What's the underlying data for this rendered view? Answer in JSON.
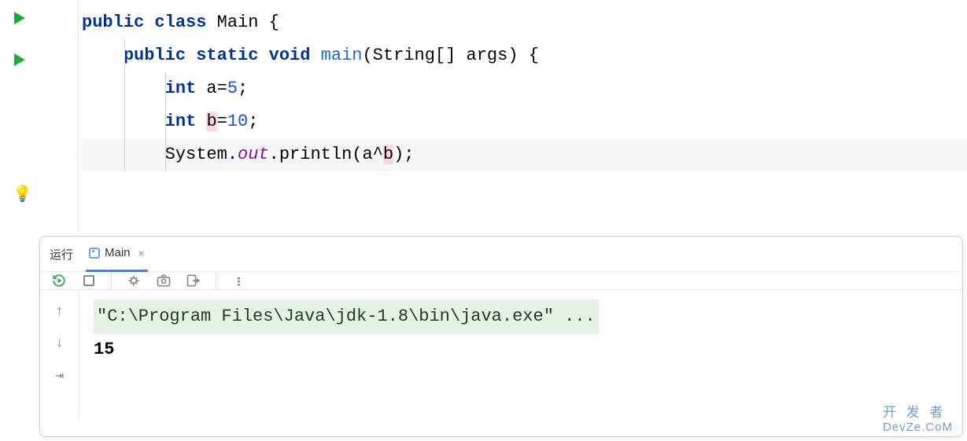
{
  "code": {
    "lines": [
      {
        "gutter": "run",
        "tokens": [
          {
            "t": "kw",
            "v": "public"
          },
          {
            "t": "plain",
            "v": " "
          },
          {
            "t": "kw",
            "v": "class"
          },
          {
            "t": "plain",
            "v": " "
          },
          {
            "t": "cls",
            "v": "Main"
          },
          {
            "t": "plain",
            "v": " {"
          }
        ]
      },
      {
        "gutter": "run",
        "indent": 1,
        "tokens": [
          {
            "t": "kw",
            "v": "public"
          },
          {
            "t": "plain",
            "v": " "
          },
          {
            "t": "kw",
            "v": "static"
          },
          {
            "t": "plain",
            "v": " "
          },
          {
            "t": "kw",
            "v": "void"
          },
          {
            "t": "plain",
            "v": " "
          },
          {
            "t": "method",
            "v": "main"
          },
          {
            "t": "plain",
            "v": "(String[] args) {"
          }
        ]
      },
      {
        "indent": 2,
        "tokens": [
          {
            "t": "kw",
            "v": "int"
          },
          {
            "t": "plain",
            "v": " a="
          },
          {
            "t": "num",
            "v": "5"
          },
          {
            "t": "plain",
            "v": ";"
          }
        ]
      },
      {
        "indent": 2,
        "tokens": [
          {
            "t": "kw",
            "v": "int"
          },
          {
            "t": "plain",
            "v": " "
          },
          {
            "t": "highlight-char",
            "v": "b"
          },
          {
            "t": "plain",
            "v": "="
          },
          {
            "t": "num",
            "v": "10"
          },
          {
            "t": "plain",
            "v": ";"
          }
        ]
      },
      {
        "gutter": "bulb",
        "highlighted": true,
        "indent": 2,
        "tokens": [
          {
            "t": "plain",
            "v": "System."
          },
          {
            "t": "field-static",
            "v": "out"
          },
          {
            "t": "plain",
            "v": ".println(a^"
          },
          {
            "t": "highlight-char",
            "v": "b"
          },
          {
            "t": "plain",
            "v": ");"
          }
        ]
      }
    ]
  },
  "run_panel": {
    "title": "运行",
    "tab_name": "Main",
    "tab_close": "×",
    "output_command": "\"C:\\Program Files\\Java\\jdk-1.8\\bin\\java.exe\" ...",
    "output_result": "15"
  },
  "watermark": {
    "line1": "开 发 者",
    "line2": "DevZe.CoM"
  }
}
